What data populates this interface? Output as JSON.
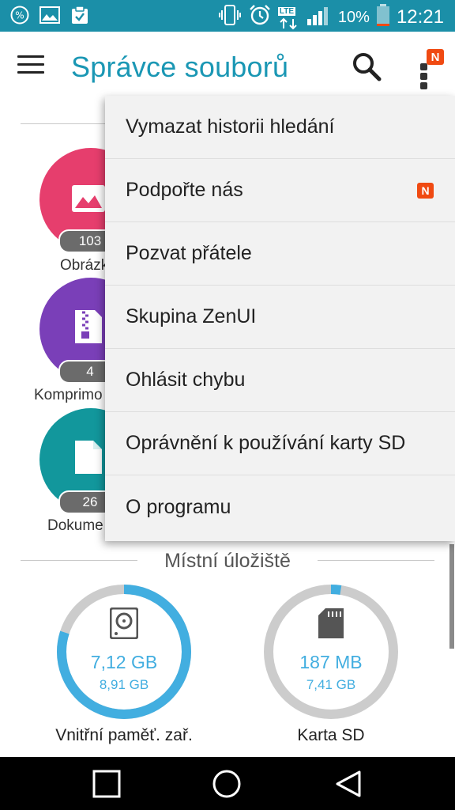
{
  "status_bar": {
    "battery": "10%",
    "time": "12:21",
    "network": "LTE",
    "left_icons": [
      "percent-icon",
      "image-icon",
      "clipboard-check-icon"
    ],
    "right_icons": [
      "vibrate-icon",
      "alarm-icon",
      "lte-icon",
      "signal-icon",
      "battery-icon"
    ]
  },
  "app_bar": {
    "title": "Správce souborů",
    "notification_badge": "N"
  },
  "categories": [
    {
      "label": "Obrázk",
      "count": "103",
      "color": "#e63e6d",
      "icon": "image-icon"
    },
    {
      "label": "Komprimo",
      "count": "4",
      "color": "#7a3fb8",
      "icon": "zip-file-icon"
    },
    {
      "label": "Dokume",
      "count": "26",
      "color": "#12979c",
      "icon": "document-icon"
    }
  ],
  "menu": {
    "items": [
      {
        "label": "Vymazat historii hledání"
      },
      {
        "label": "Podpořte nás",
        "badge": "N"
      },
      {
        "label": "Pozvat přátele"
      },
      {
        "label": "Skupina ZenUI"
      },
      {
        "label": "Ohlásit chybu"
      },
      {
        "label": "Oprávnění k používání karty SD"
      },
      {
        "label": "O programu"
      }
    ]
  },
  "local_storage": {
    "title": "Místní úložiště",
    "items": [
      {
        "label": "Vnitřní paměť. zař.",
        "used": "7,12 GB",
        "total": "8,91 GB",
        "used_fraction": 0.8,
        "icon": "hard-drive-icon"
      },
      {
        "label": "Karta SD",
        "used": "187 MB",
        "total": "7,41 GB",
        "used_fraction": 0.025,
        "icon": "sd-card-icon"
      }
    ]
  },
  "colors": {
    "status_bar": "#1b8fa8",
    "title": "#1a97b4",
    "ring_used": "#42aee0",
    "ring_free": "#cccccc",
    "badge": "#f04a12"
  }
}
